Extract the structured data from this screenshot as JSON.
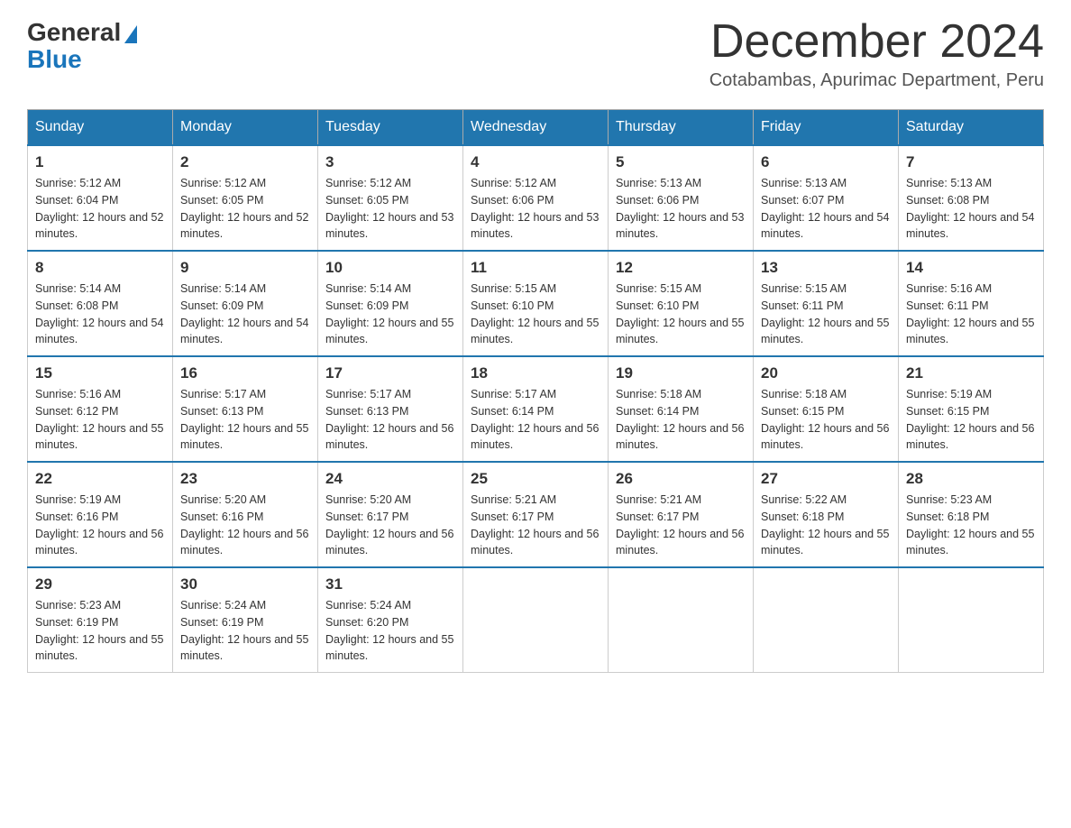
{
  "header": {
    "logo_general": "General",
    "logo_blue": "Blue",
    "month_title": "December 2024",
    "location": "Cotabambas, Apurimac Department, Peru"
  },
  "weekdays": [
    "Sunday",
    "Monday",
    "Tuesday",
    "Wednesday",
    "Thursday",
    "Friday",
    "Saturday"
  ],
  "weeks": [
    [
      {
        "day": "1",
        "sunrise": "5:12 AM",
        "sunset": "6:04 PM",
        "daylight": "12 hours and 52 minutes."
      },
      {
        "day": "2",
        "sunrise": "5:12 AM",
        "sunset": "6:05 PM",
        "daylight": "12 hours and 52 minutes."
      },
      {
        "day": "3",
        "sunrise": "5:12 AM",
        "sunset": "6:05 PM",
        "daylight": "12 hours and 53 minutes."
      },
      {
        "day": "4",
        "sunrise": "5:12 AM",
        "sunset": "6:06 PM",
        "daylight": "12 hours and 53 minutes."
      },
      {
        "day": "5",
        "sunrise": "5:13 AM",
        "sunset": "6:06 PM",
        "daylight": "12 hours and 53 minutes."
      },
      {
        "day": "6",
        "sunrise": "5:13 AM",
        "sunset": "6:07 PM",
        "daylight": "12 hours and 54 minutes."
      },
      {
        "day": "7",
        "sunrise": "5:13 AM",
        "sunset": "6:08 PM",
        "daylight": "12 hours and 54 minutes."
      }
    ],
    [
      {
        "day": "8",
        "sunrise": "5:14 AM",
        "sunset": "6:08 PM",
        "daylight": "12 hours and 54 minutes."
      },
      {
        "day": "9",
        "sunrise": "5:14 AM",
        "sunset": "6:09 PM",
        "daylight": "12 hours and 54 minutes."
      },
      {
        "day": "10",
        "sunrise": "5:14 AM",
        "sunset": "6:09 PM",
        "daylight": "12 hours and 55 minutes."
      },
      {
        "day": "11",
        "sunrise": "5:15 AM",
        "sunset": "6:10 PM",
        "daylight": "12 hours and 55 minutes."
      },
      {
        "day": "12",
        "sunrise": "5:15 AM",
        "sunset": "6:10 PM",
        "daylight": "12 hours and 55 minutes."
      },
      {
        "day": "13",
        "sunrise": "5:15 AM",
        "sunset": "6:11 PM",
        "daylight": "12 hours and 55 minutes."
      },
      {
        "day": "14",
        "sunrise": "5:16 AM",
        "sunset": "6:11 PM",
        "daylight": "12 hours and 55 minutes."
      }
    ],
    [
      {
        "day": "15",
        "sunrise": "5:16 AM",
        "sunset": "6:12 PM",
        "daylight": "12 hours and 55 minutes."
      },
      {
        "day": "16",
        "sunrise": "5:17 AM",
        "sunset": "6:13 PM",
        "daylight": "12 hours and 55 minutes."
      },
      {
        "day": "17",
        "sunrise": "5:17 AM",
        "sunset": "6:13 PM",
        "daylight": "12 hours and 56 minutes."
      },
      {
        "day": "18",
        "sunrise": "5:17 AM",
        "sunset": "6:14 PM",
        "daylight": "12 hours and 56 minutes."
      },
      {
        "day": "19",
        "sunrise": "5:18 AM",
        "sunset": "6:14 PM",
        "daylight": "12 hours and 56 minutes."
      },
      {
        "day": "20",
        "sunrise": "5:18 AM",
        "sunset": "6:15 PM",
        "daylight": "12 hours and 56 minutes."
      },
      {
        "day": "21",
        "sunrise": "5:19 AM",
        "sunset": "6:15 PM",
        "daylight": "12 hours and 56 minutes."
      }
    ],
    [
      {
        "day": "22",
        "sunrise": "5:19 AM",
        "sunset": "6:16 PM",
        "daylight": "12 hours and 56 minutes."
      },
      {
        "day": "23",
        "sunrise": "5:20 AM",
        "sunset": "6:16 PM",
        "daylight": "12 hours and 56 minutes."
      },
      {
        "day": "24",
        "sunrise": "5:20 AM",
        "sunset": "6:17 PM",
        "daylight": "12 hours and 56 minutes."
      },
      {
        "day": "25",
        "sunrise": "5:21 AM",
        "sunset": "6:17 PM",
        "daylight": "12 hours and 56 minutes."
      },
      {
        "day": "26",
        "sunrise": "5:21 AM",
        "sunset": "6:17 PM",
        "daylight": "12 hours and 56 minutes."
      },
      {
        "day": "27",
        "sunrise": "5:22 AM",
        "sunset": "6:18 PM",
        "daylight": "12 hours and 55 minutes."
      },
      {
        "day": "28",
        "sunrise": "5:23 AM",
        "sunset": "6:18 PM",
        "daylight": "12 hours and 55 minutes."
      }
    ],
    [
      {
        "day": "29",
        "sunrise": "5:23 AM",
        "sunset": "6:19 PM",
        "daylight": "12 hours and 55 minutes."
      },
      {
        "day": "30",
        "sunrise": "5:24 AM",
        "sunset": "6:19 PM",
        "daylight": "12 hours and 55 minutes."
      },
      {
        "day": "31",
        "sunrise": "5:24 AM",
        "sunset": "6:20 PM",
        "daylight": "12 hours and 55 minutes."
      },
      null,
      null,
      null,
      null
    ]
  ]
}
